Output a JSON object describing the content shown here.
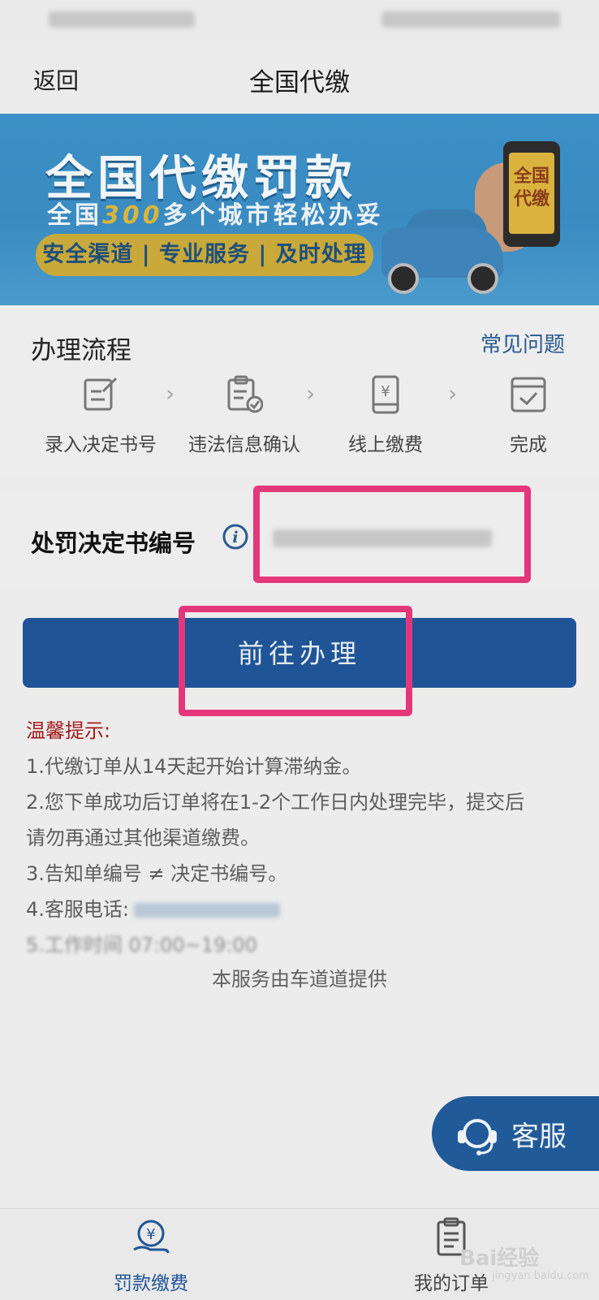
{
  "nav": {
    "back_label": "返回",
    "title": "全国代缴"
  },
  "banner": {
    "title": "全国代缴罚款",
    "subtitle_pre": "全国",
    "subtitle_num": "300",
    "subtitle_post": "多个城市轻松办妥",
    "pill": "安全渠道 | 专业服务 | 及时处理",
    "phone_text": "全国代缴"
  },
  "process": {
    "title": "办理流程",
    "faq_label": "常见问题",
    "steps": [
      {
        "label": "录入决定书号",
        "icon": "edit-form-icon"
      },
      {
        "label": "违法信息确认",
        "icon": "checklist-icon"
      },
      {
        "label": "线上缴费",
        "icon": "phone-payment-icon"
      },
      {
        "label": "完成",
        "icon": "checkbox-done-icon"
      }
    ]
  },
  "form": {
    "label": "处罚决定书编号",
    "info_icon": "info-icon"
  },
  "go_button": "前往办理",
  "tips": {
    "title": "温馨提示:",
    "line1": "1.代缴订单从14天起开始计算滞纳金。",
    "line2": "2.您下单成功后订单将在1-2个工作日内处理完毕，提交后",
    "line3": "请勿再通过其他渠道缴费。",
    "line4": "3.告知单编号 ≠ 决定书编号。",
    "line5": "4.客服电话:",
    "line6": "5.工作时间 07:00~19:00"
  },
  "footer_note": "本服务由车道道提供",
  "customer_service": {
    "label": "客服",
    "icon": "headset-icon"
  },
  "tabbar": [
    {
      "label": "罚款缴费",
      "icon": "yen-payment-icon",
      "active": true,
      "color": "#1f5597"
    },
    {
      "label": "我的订单",
      "icon": "clipboard-icon",
      "active": false,
      "color": "#444444"
    }
  ],
  "watermark": {
    "text": "Bai经验",
    "sub": "jingyan.baidu.com"
  },
  "colors": {
    "primary": "#1f5597",
    "highlight": "#e4377a",
    "tip_title": "#a31b1b"
  }
}
